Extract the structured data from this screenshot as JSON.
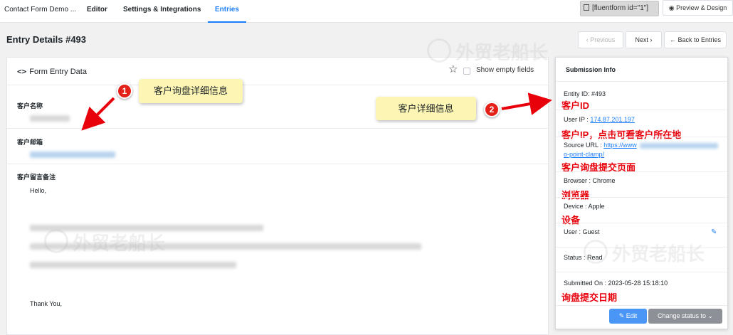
{
  "nav": {
    "form_name": "Contact Form Demo ...",
    "tabs": [
      {
        "label": "Editor"
      },
      {
        "label": "Settings & Integrations"
      },
      {
        "label": "Entries"
      }
    ],
    "shortcode": "[fluentform id=\"1\"]",
    "preview_label": "Preview & Design"
  },
  "header": {
    "title": "Entry Details #493",
    "previous_label": "Previous",
    "next_label": "Next",
    "back_label": "Back to Entries"
  },
  "entry": {
    "title": "Form Entry Data",
    "show_empty_label": "Show empty fields",
    "fields": [
      {
        "label": "客户名称"
      },
      {
        "label": "客户邮箱"
      },
      {
        "label": "客户留言备注"
      }
    ],
    "message_greeting": "Hello,",
    "message_closing": "Thank You,"
  },
  "submission": {
    "title": "Submission Info",
    "entry_id": "Entity ID: #493",
    "user_ip_label": "User IP : ",
    "user_ip": "174.87.201.197",
    "source_url_label": "Source URL : ",
    "source_url_start": "https://www",
    "source_url_end": "o-point-clamp/",
    "browser": "Browser : Chrome",
    "device": "Device : Apple",
    "user": "User : Guest",
    "status": "Status : Read",
    "submitted_on": "Submitted On : 2023-05-28 15:18:10",
    "edit_label": "Edit",
    "change_status_label": "Change status to"
  },
  "annotations": {
    "callout_1": {
      "number": "1",
      "text": "客户询盘详细信息"
    },
    "callout_2": {
      "number": "2",
      "text": "客户详细信息"
    },
    "notes": {
      "id": "客户ID",
      "ip": "客户IP，点击可看客户所在地",
      "source": "客户询盘提交页面",
      "browser": "浏览器",
      "device": "设备",
      "date": "询盘提交日期"
    },
    "accent_color": "#e8000b"
  },
  "watermark": "外贸老船长",
  "colors": {
    "primary": "#1a7efb",
    "annotation_red": "#e8000b",
    "callout_bg": "#fdf5b4",
    "status_button": "#8d9096"
  }
}
